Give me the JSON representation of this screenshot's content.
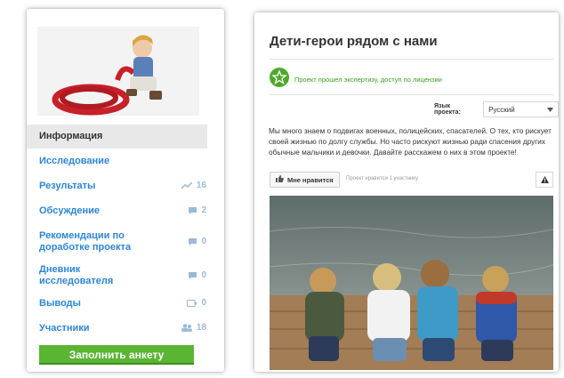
{
  "sidebar": {
    "items": [
      {
        "label": "Информация",
        "active": true
      },
      {
        "label": "Исследование"
      },
      {
        "label": "Результаты",
        "count": "16",
        "icon": "chart-icon"
      },
      {
        "label": "Обсуждение",
        "count": "2",
        "icon": "comment-icon"
      },
      {
        "label": "Рекомендации по доработке проекта",
        "count": "0",
        "icon": "comment-icon"
      },
      {
        "label": "Дневник исследователя",
        "count": "0",
        "icon": "comment-icon"
      },
      {
        "label": "Выводы",
        "count": "0",
        "icon": "battery-icon"
      },
      {
        "label": "Участники",
        "count": "18",
        "icon": "people-icon"
      }
    ],
    "cta_label": "Заполнить анкету"
  },
  "project": {
    "title": "Дети-герои рядом с нами",
    "approved": "Проект прошел экспертизу, доступ по лицензии",
    "language_label": "Язык проекта:",
    "language_value": "Русский",
    "description": "Мы много знаем о подвигах военных, полицейских, спасателей. О тех, кто рискует своей жизнью по долгу службы. Но часто рискуют жизнью ради спасения других обычные мальчики и девочки. Давайте расскажем о них в этом проекте!",
    "like_label": "Мне нравится",
    "like_note": "Проект нравится 1 участнику"
  },
  "colors": {
    "link_blue": "#2c86d6",
    "cta_green": "#5ab533",
    "approved_green": "#3a9e1e",
    "icon_grey": "#9db8d9"
  }
}
